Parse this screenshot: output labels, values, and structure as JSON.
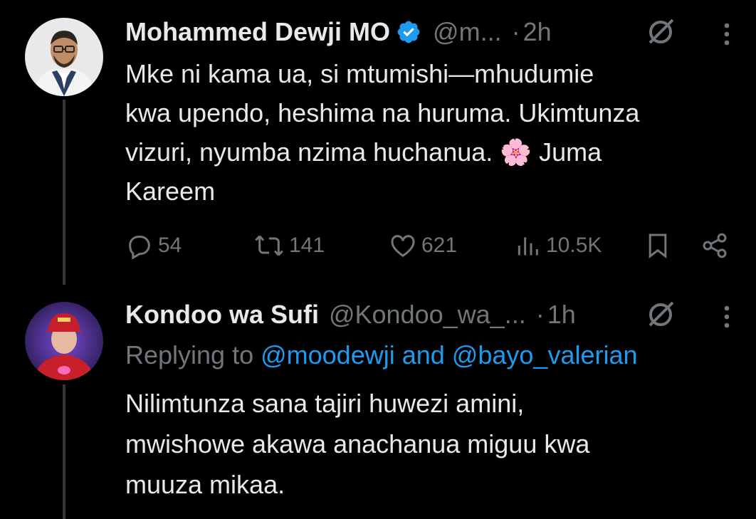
{
  "tweets": [
    {
      "author_name": "Mohammed Dewji MO",
      "handle": "@m...",
      "separator": "·",
      "time": "2h",
      "verified": true,
      "text_lines": [
        "Mke ni kama ua, si mtumishi—mhudumie",
        "kwa upendo, heshima na huruma. Ukimtunza",
        "vizuri, nyumba nzima huchanua. 🌸 Juma",
        "Kareem"
      ],
      "actions": {
        "replies": "54",
        "reposts": "141",
        "likes": "621",
        "views": "10.5K"
      }
    },
    {
      "author_name": "Kondoo wa Sufi",
      "handle": "@Kondoo_wa_...",
      "separator": "·",
      "time": "1h",
      "reply_prefix": "Replying to ",
      "reply_mention_1": "@moodewji",
      "reply_and": " and ",
      "reply_mention_2": "@bayo_valerian",
      "text_lines": [
        "Nilimtunza sana tajiri huwezi amini,",
        "mwishowe akawa anachanua miguu kwa",
        "muuza mikaa."
      ]
    }
  ],
  "colors": {
    "background": "#000000",
    "text": "#e7e9ea",
    "secondary": "#71767b",
    "accent": "#1d9bf0"
  }
}
